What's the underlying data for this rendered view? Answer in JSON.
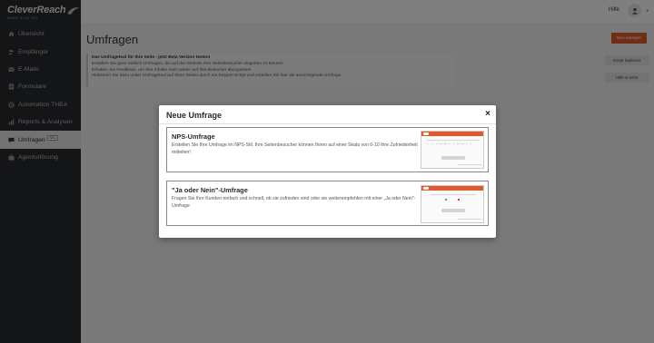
{
  "app": {
    "logo_text": "CleverReach",
    "logo_sub": "GmbH & Co. KG"
  },
  "sidebar": {
    "items": [
      {
        "label": "Übersicht",
        "icon": "home-icon",
        "active": false
      },
      {
        "label": "Empfänger",
        "icon": "users-icon",
        "active": false
      },
      {
        "label": "E-Mails",
        "icon": "mail-icon",
        "active": false
      },
      {
        "label": "Formulare",
        "icon": "form-icon",
        "active": false
      },
      {
        "label": "Automation THEA",
        "icon": "automation-icon",
        "active": false
      },
      {
        "label": "Reports & Analysen",
        "icon": "chart-icon",
        "active": false
      },
      {
        "label": "Umfragen",
        "icon": "survey-icon",
        "active": true,
        "badge": "NEU"
      },
      {
        "label": "Agenturlösung",
        "icon": "agency-icon",
        "active": false
      }
    ]
  },
  "topbar": {
    "help_label": "Hilfe",
    "avatar_icon": "user-icon",
    "caret": "v"
  },
  "main": {
    "title": "Umfragen",
    "new_button_label": "Neu anlegen",
    "info": {
      "heading": "Das Umfragetool für Ihre Seite - jetzt Beta Version testen!",
      "lines": [
        "Erstellen Sie ganz einfach Umfragen, die auf der Website Ihre Seitenbesucher eingeben zu können.",
        "Erhalten Sie Feedback, um Ihre Inhalte noch weiter auf Ihre Besucher abzupassen.",
        "Aktivieren Sie dazu unser Umfragetool auf Ihren Seiten durch ein Snippet Script und erstellen Sie hier die anzuzeigende Umfrage."
      ]
    },
    "script_button_label": "Script kopieren",
    "help_button_label": "Hilfe & Infos"
  },
  "modal": {
    "title": "Neue Umfrage",
    "close_symbol": "×",
    "options": [
      {
        "title": "NPS-Umfrage",
        "description": "Erstellen Sie Ihre Umfrage im NPS-Stil. Ihre Seitenbesucher können Ihnen auf einer Skala von 0-10 Ihre Zufriedenheit mitteilen!"
      },
      {
        "title": "\"Ja oder Nein\"-Umfrage",
        "description": "Fragen Sie Ihre Kunden einfach und schnell, ob sie zufrieden sind oder sie weiterempfehlen mit einer „Ja oder Nein\"-Umfrage"
      }
    ]
  },
  "colors": {
    "accent": "#e05a2b",
    "sidebar_bg": "#272a2f",
    "yes": "#4caf50",
    "no": "#e53935"
  }
}
